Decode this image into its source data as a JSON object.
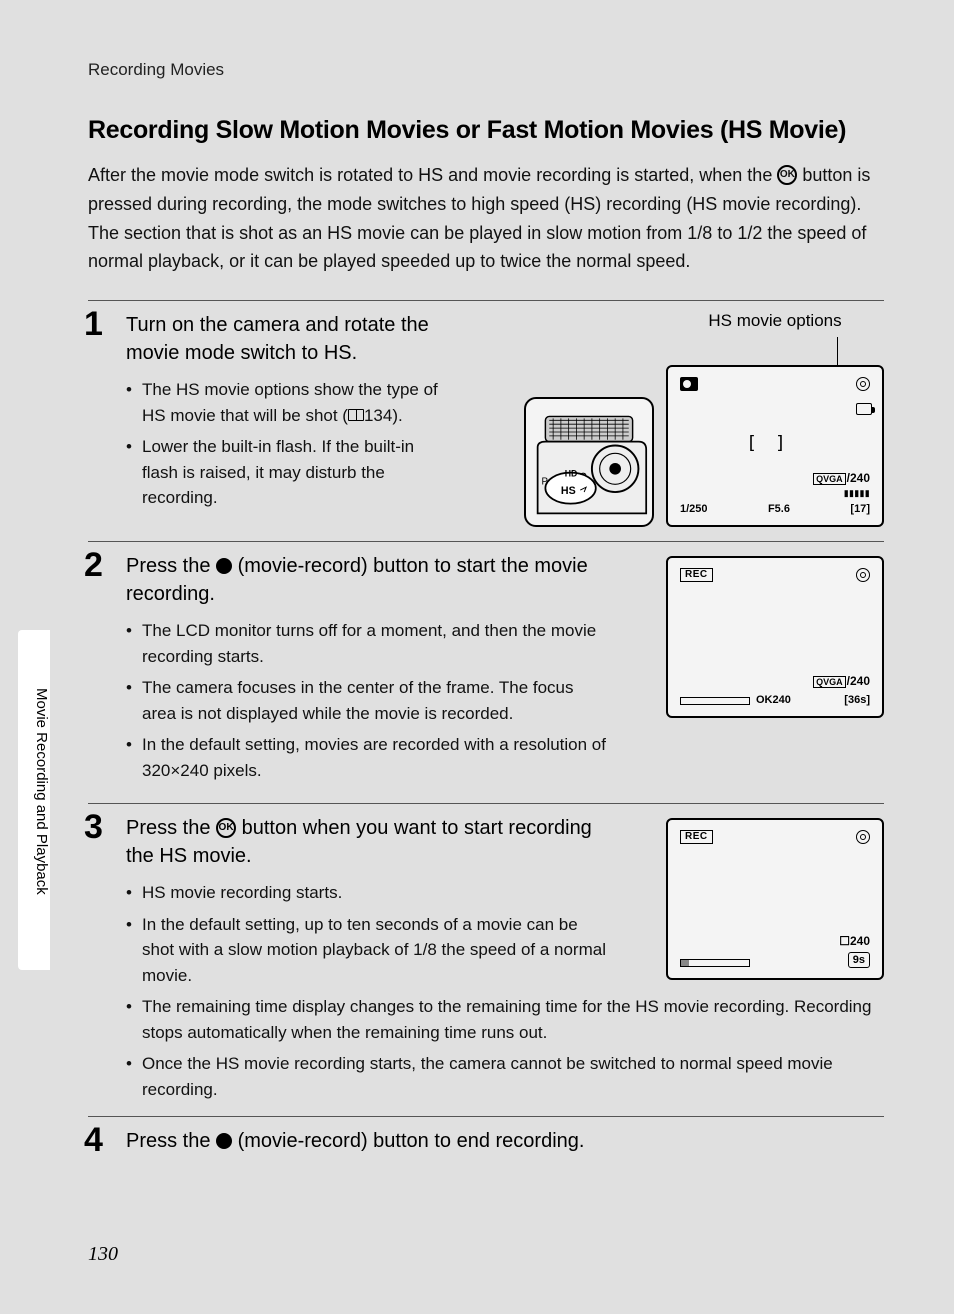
{
  "header": "Recording Movies",
  "title": "Recording Slow Motion Movies or Fast Motion Movies (HS Movie)",
  "intro_parts": {
    "p1": "After the movie mode switch is rotated to HS and movie recording is started, when the ",
    "p2": " button is pressed during recording, the mode switches to high speed (HS) recording (HS movie recording). The section that is shot as an HS movie can be played in slow motion from 1/8 to 1/2 the speed of normal playback, or it can be played speeded up to twice the normal speed."
  },
  "annot": "HS movie options",
  "steps": [
    {
      "num": "1",
      "title_pre": "Turn on the camera and rotate the movie mode switch to HS.",
      "bullets": [
        {
          "pre": "The HS movie options show the type of HS movie that will be shot (",
          "ref": "134",
          "post": ")."
        },
        {
          "text": "Lower the built-in flash. If the built-in flash is raised, it may disturb the recording."
        }
      ]
    },
    {
      "num": "2",
      "title_pre": "Press the ",
      "title_post": " (movie-record) button to start the movie recording.",
      "bullets": [
        {
          "text": "The LCD monitor turns off for a moment, and then the movie recording starts."
        },
        {
          "text": "The camera focuses in the center of the frame. The focus area is not displayed while the movie is recorded."
        },
        {
          "text": "In the default setting, movies are recorded with a resolution of 320×240 pixels."
        }
      ]
    },
    {
      "num": "3",
      "title_pre": "Press the ",
      "title_post": " button when you want to start recording the HS movie.",
      "bullets": [
        {
          "text": "HS movie recording starts."
        },
        {
          "text": "In the default setting, up to ten seconds of a movie can be shot with a slow motion playback of 1/8 the speed of a normal movie."
        },
        {
          "text": "The remaining time display changes to the remaining time for the HS movie recording. Recording stops automatically when the remaining time runs out."
        },
        {
          "text": "Once the HS movie recording starts, the camera cannot be switched to normal speed movie recording."
        }
      ]
    },
    {
      "num": "4",
      "title_pre": "Press the ",
      "title_post": " (movie-record) button to end recording."
    }
  ],
  "sidebar": "Movie Recording and Playback",
  "page_number": "130",
  "lcd1": {
    "shutter": "1/250",
    "fstop": "F5.6",
    "mode_label": "QVGA",
    "fps": "/240",
    "count": "17"
  },
  "lcd2": {
    "rec": "REC",
    "mode_label": "QVGA",
    "fps": "/240",
    "ok": "OK240",
    "time": "36s"
  },
  "lcd3": {
    "rec": "REC",
    "fps": "240",
    "time": "9s"
  },
  "cam_labels": {
    "hd": "HD",
    "hs": "HS",
    "p": "P"
  }
}
